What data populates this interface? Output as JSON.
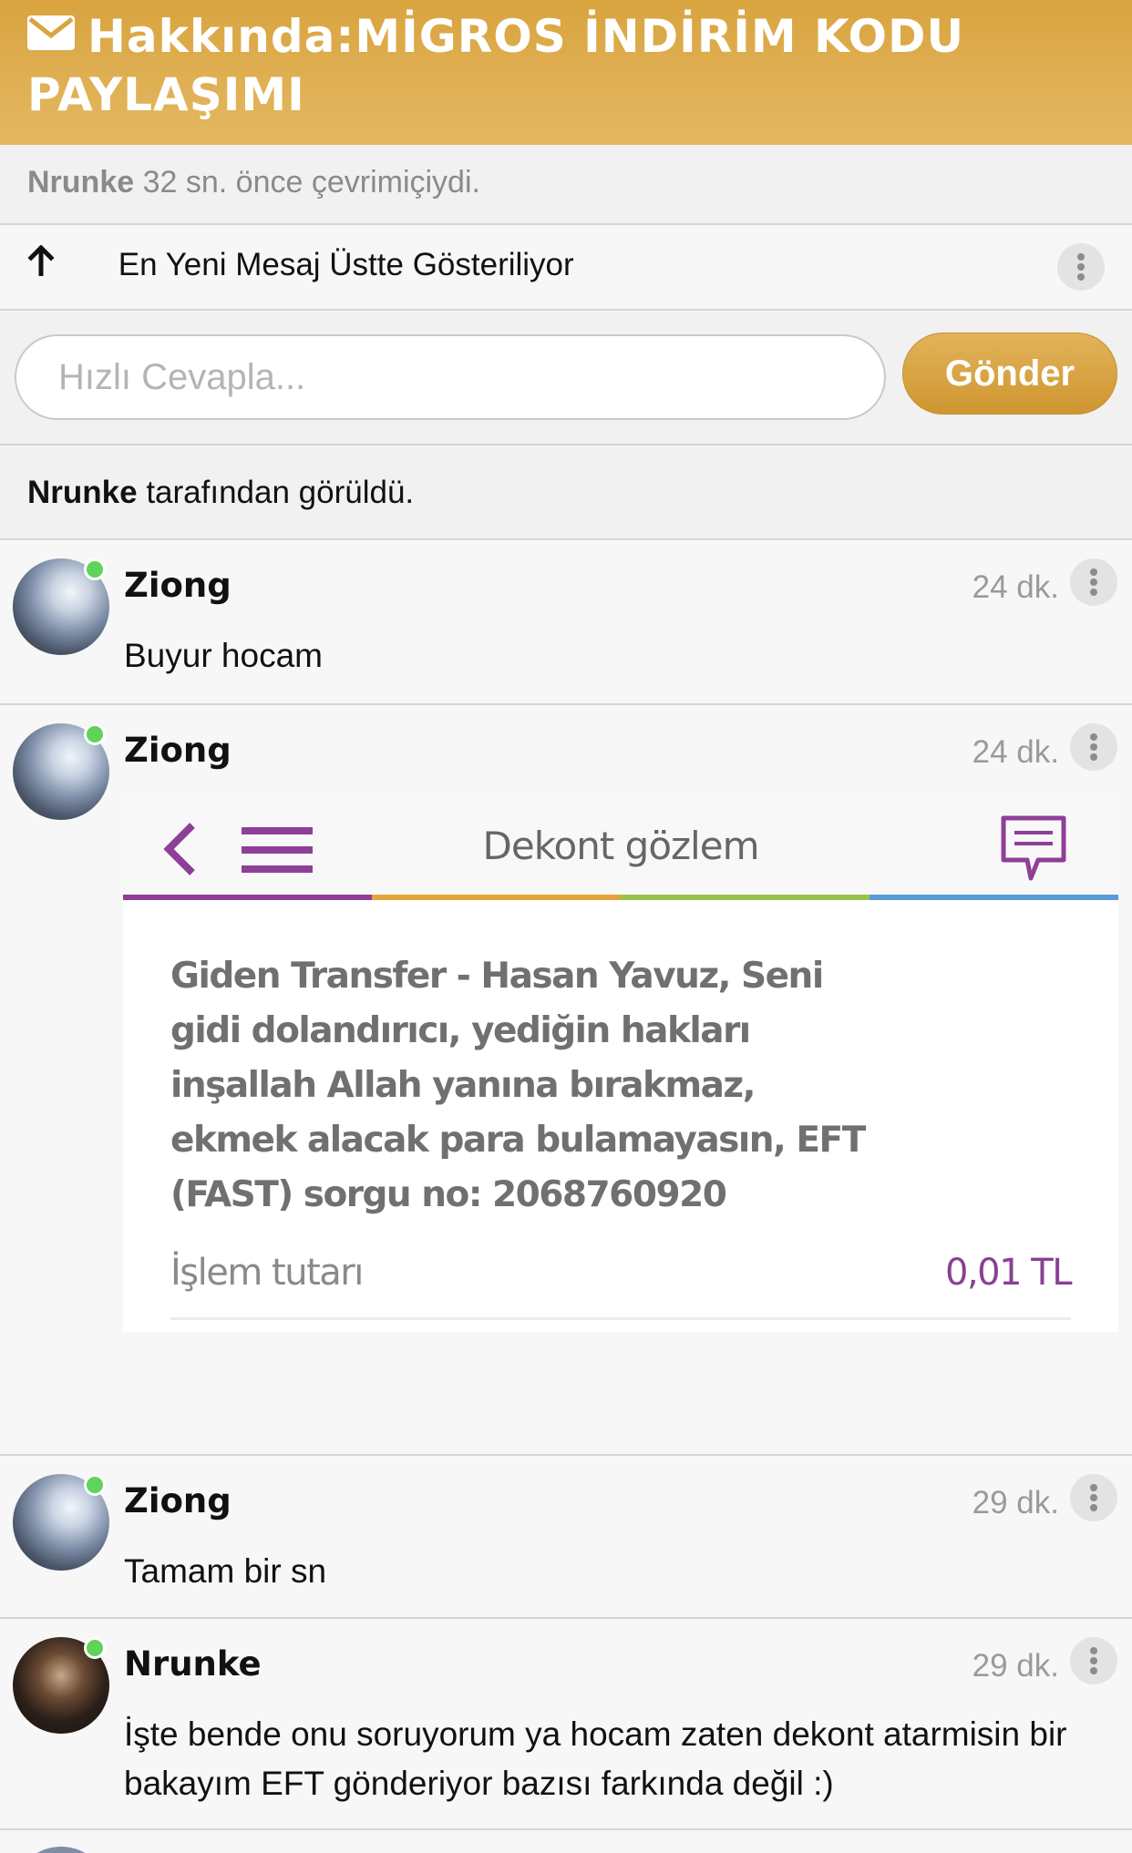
{
  "header": {
    "icon": "envelope-icon",
    "title": "Hakkında:MİGROS İNDİRİM KODU PAYLAŞIMI",
    "accent_color": "#d9a43f"
  },
  "status": {
    "username": "Nrunke",
    "text": "32 sn. önce çevrimiçiydi."
  },
  "order_bar": {
    "icon": "arrow-up-icon",
    "text": "En Yeni Mesaj Üstte Gösteriliyor"
  },
  "reply": {
    "placeholder": "Hızlı Cevapla...",
    "send_label": "Gönder"
  },
  "seen": {
    "username": "Nrunke",
    "text": "tarafından görüldü."
  },
  "messages": [
    {
      "user": "Ziong",
      "time": "24 dk.",
      "text": "Buyur hocam",
      "online": true
    },
    {
      "user": "Ziong",
      "time": "24 dk.",
      "online": true,
      "attachment": {
        "title": "Dekont gözlem",
        "description": "Giden Transfer - Hasan Yavuz, Seni gidi dolandırıcı, yediğin hakları inşallah Allah yanına bırakmaz, ekmek alacak para bulamayasın, EFT (FAST) sorgu no: 2068760920",
        "amount_label": "İşlem tutarı",
        "amount": "0,01 TL"
      }
    },
    {
      "user": "Ziong",
      "time": "29 dk.",
      "text": "Tamam bir sn",
      "online": true
    },
    {
      "user": "Nrunke",
      "time": "29 dk.",
      "text": "İşte bende onu soruyorum ya hocam zaten dekont atarmisin bir bakayım EFT gönderiyor bazısı farkında değil :)",
      "online": true
    }
  ]
}
